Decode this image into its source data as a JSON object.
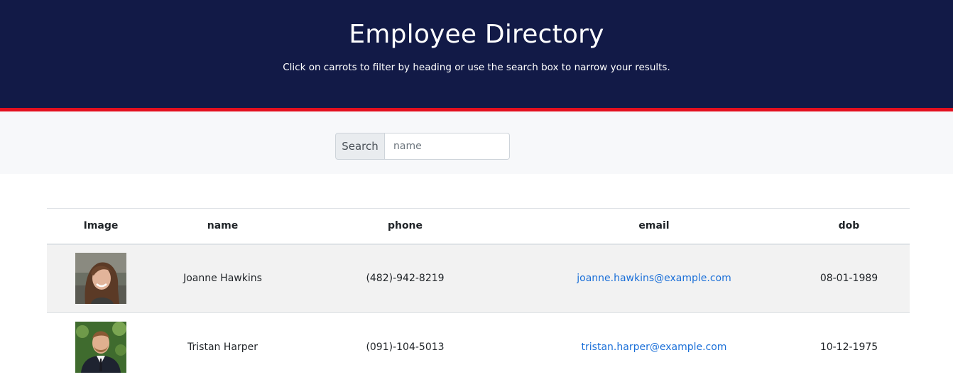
{
  "header": {
    "title": "Employee Directory",
    "subtitle": "Click on carrots to filter by heading or use the search box to narrow your results."
  },
  "search": {
    "label": "Search",
    "placeholder": "name",
    "value": ""
  },
  "table": {
    "columns": [
      "Image",
      "name",
      "phone",
      "email",
      "dob"
    ],
    "rows": [
      {
        "name": "Joanne Hawkins",
        "phone": "(482)-942-8219",
        "email": "joanne.hawkins@example.com",
        "dob": "08-01-1989"
      },
      {
        "name": "Tristan Harper",
        "phone": "(091)-104-5013",
        "email": "tristan.harper@example.com",
        "dob": "10-12-1975"
      }
    ]
  },
  "colors": {
    "header_bg": "#121a47",
    "accent_bar": "#e3101f",
    "link": "#1a6fd8"
  }
}
